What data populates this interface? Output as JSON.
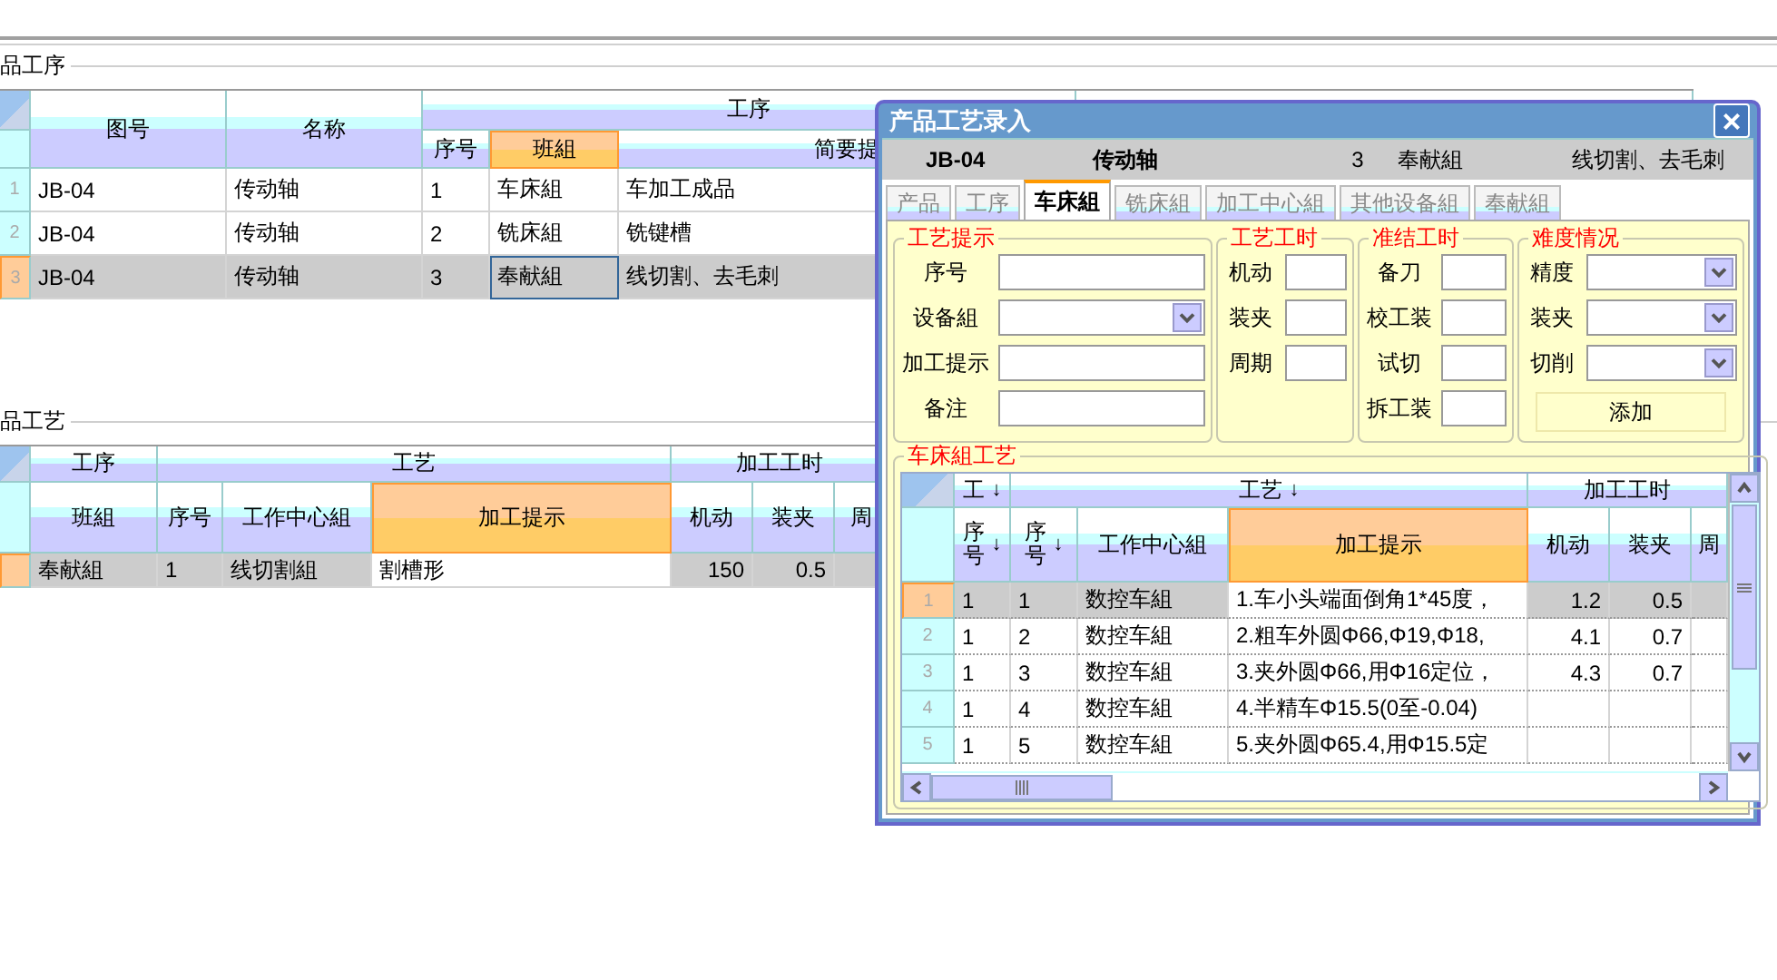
{
  "top_panel": {
    "title": "品工序",
    "grid": {
      "header": [
        {
          "kind": "column",
          "label": "图号",
          "selected": false
        },
        {
          "kind": "column",
          "label": "名称",
          "selected": false
        },
        {
          "kind": "group",
          "label": "工序",
          "columns": [
            {
              "label": "序号",
              "selected": false
            },
            {
              "label": "班組",
              "selected": true
            },
            {
              "label": "简要提",
              "selected": false
            }
          ]
        },
        {
          "kind": "group"
        }
      ],
      "rows": [
        {
          "number": "1",
          "selected": false,
          "cells": [
            "JB-04",
            "传动轴",
            "1",
            "车床組",
            "车加工成品"
          ]
        },
        {
          "number": "2",
          "selected": false,
          "cells": [
            "JB-04",
            "传动轴",
            "2",
            "铣床組",
            "铣键槽"
          ]
        },
        {
          "number": "3",
          "selected": true,
          "cells": [
            "JB-04",
            "传动轴",
            "3",
            "奉献組",
            "线切割、去毛刺"
          ]
        }
      ]
    }
  },
  "bottom_panel": {
    "title": "品工艺",
    "grid": {
      "header": [
        {
          "kind": "group",
          "label": "工序",
          "columns": [
            {
              "label": "班組",
              "selected": false
            }
          ]
        },
        {
          "kind": "group",
          "label": "工艺",
          "columns": [
            {
              "label": "序号",
              "selected": false
            },
            {
              "label": "工作中心組",
              "selected": false
            },
            {
              "label": "加工提示",
              "selected": true
            }
          ]
        },
        {
          "kind": "group",
          "label": "加工工时",
          "columns": [
            {
              "label": "机动",
              "selected": false,
              "numeric": true
            },
            {
              "label": "装夹",
              "selected": false,
              "numeric": true
            },
            {
              "label": "周",
              "selected": false
            }
          ]
        }
      ],
      "rows": [
        {
          "selected": true,
          "cells": [
            "奉献組",
            "1",
            "线切割組",
            "割槽形",
            "150",
            "0.5"
          ]
        }
      ]
    }
  },
  "dialog": {
    "title": "产品工艺录入",
    "close": "×",
    "record": [
      "JB-04",
      "传动轴",
      "3",
      "奉献組",
      "线切割、去毛刺"
    ],
    "tabs": [
      {
        "label": "产品",
        "selected": false
      },
      {
        "label": "工序",
        "selected": false
      },
      {
        "label": "车床組",
        "selected": true
      },
      {
        "label": "铣床組",
        "selected": false
      },
      {
        "label": "加工中心組",
        "selected": false
      },
      {
        "label": "其他设备組",
        "selected": false
      },
      {
        "label": "奉献組",
        "selected": false
      }
    ],
    "groups": [
      {
        "title": "工艺提示",
        "fields": [
          {
            "label": "序号",
            "kind": "text"
          },
          {
            "label": "设备組",
            "kind": "select"
          },
          {
            "label": "加工提示",
            "kind": "text"
          },
          {
            "label": "备注",
            "kind": "text"
          }
        ]
      },
      {
        "title": "工艺工时",
        "fields": [
          {
            "label": "机动",
            "kind": "text"
          },
          {
            "label": "装夹",
            "kind": "text"
          },
          {
            "label": "周期",
            "kind": "text"
          }
        ]
      },
      {
        "title": "准结工时",
        "fields": [
          {
            "label": "备刀",
            "kind": "text"
          },
          {
            "label": "校工装",
            "kind": "text"
          },
          {
            "label": "试切",
            "kind": "text"
          },
          {
            "label": "拆工装",
            "kind": "text"
          }
        ]
      },
      {
        "title": "难度情况",
        "fields": [
          {
            "label": "精度",
            "kind": "select"
          },
          {
            "label": "装夹",
            "kind": "select"
          },
          {
            "label": "切削",
            "kind": "select"
          }
        ],
        "button": "添加"
      }
    ],
    "process": {
      "title": "车床組工艺",
      "grid": {
        "header": [
          {
            "kind": "group",
            "label": "工",
            "sort": "↓",
            "columns": [
              {
                "label": "序号",
                "sort": "↓",
                "selected": false
              }
            ]
          },
          {
            "kind": "group",
            "label": "工艺",
            "sort": "↓",
            "columns": [
              {
                "label": "序号",
                "sort": "↓",
                "selected": false
              },
              {
                "label": "工作中心組",
                "selected": false
              },
              {
                "label": "加工提示",
                "selected": true
              }
            ]
          },
          {
            "kind": "group",
            "label": "加工工时",
            "columns": [
              {
                "label": "机动",
                "selected": false,
                "numeric": true
              },
              {
                "label": "装夹",
                "selected": false,
                "numeric": true
              },
              {
                "label": "周",
                "selected": false
              }
            ]
          }
        ],
        "rows": [
          {
            "number": "1",
            "selected": true,
            "cells": [
              "1",
              "1",
              "数控车組",
              "1.车小头端面倒角1*45度，",
              "1.2",
              "0.5"
            ]
          },
          {
            "number": "2",
            "selected": false,
            "cells": [
              "1",
              "2",
              "数控车組",
              "2.粗车外圆Φ66,Φ19,Φ18,",
              "4.1",
              "0.7"
            ]
          },
          {
            "number": "3",
            "selected": false,
            "cells": [
              "1",
              "3",
              "数控车組",
              "3.夹外圆Φ66,用Φ16定位，",
              "4.3",
              "0.7"
            ]
          },
          {
            "number": "4",
            "selected": false,
            "cells": [
              "1",
              "4",
              "数控车組",
              "4.半精车Φ15.5(0至-0.04)"
            ]
          },
          {
            "number": "5",
            "selected": false,
            "cells": [
              "1",
              "5",
              "数控车組",
              "5.夹外圆Φ65.4,用Φ15.5定"
            ]
          }
        ]
      }
    }
  }
}
